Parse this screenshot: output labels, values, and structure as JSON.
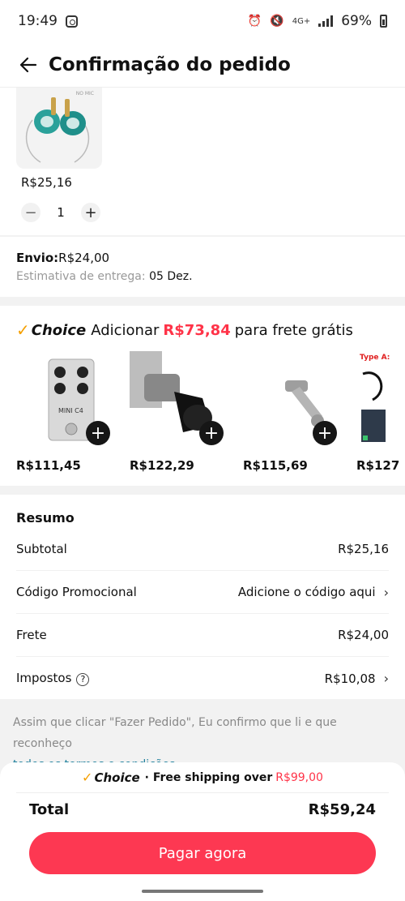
{
  "status_bar": {
    "time": "19:49",
    "network": "4G+",
    "battery": "69%"
  },
  "header": {
    "title": "Confirmação do pedido"
  },
  "product": {
    "badge": "NO MIC",
    "price": "R$25,16",
    "quantity": "1"
  },
  "shipping": {
    "fee_label": "Envio:",
    "fee_value": "R$24,00",
    "delivery_label": "Estimativa de entrega:",
    "delivery_value": "05 Dez."
  },
  "choice": {
    "check": "✓",
    "brand": "Choice",
    "add_label": "Adicionar",
    "amount": "R$73,84",
    "suffix": "para frete grátis",
    "items": [
      {
        "price": "R$111,45",
        "pedal_label": "MINI C4"
      },
      {
        "price": "R$122,29"
      },
      {
        "price": "R$115,69"
      },
      {
        "price": "R$127",
        "type_label": "Type A:"
      }
    ]
  },
  "summary": {
    "title": "Resumo",
    "rows": [
      {
        "label": "Subtotal",
        "value": "R$25,16"
      },
      {
        "label": "Código Promocional",
        "value": "Adicione o código aqui"
      },
      {
        "label": "Frete",
        "value": "R$24,00"
      },
      {
        "label": "Impostos",
        "value": "R$10,08"
      }
    ],
    "help": "?"
  },
  "terms": {
    "text": "Assim que clicar \"Fazer Pedido\", Eu confirmo que li e que reconheço",
    "link": "todos os termos e condições."
  },
  "footer": {
    "choice_brand": "Choice",
    "free_shipping": "· Free shipping over",
    "free_amount": "R$99,00",
    "total_label": "Total",
    "total_value": "R$59,24",
    "pay_label": "Pagar agora"
  },
  "colors": {
    "accent": "#fd3852",
    "choice_check": "#f5a000",
    "link": "#1d7f9c"
  }
}
